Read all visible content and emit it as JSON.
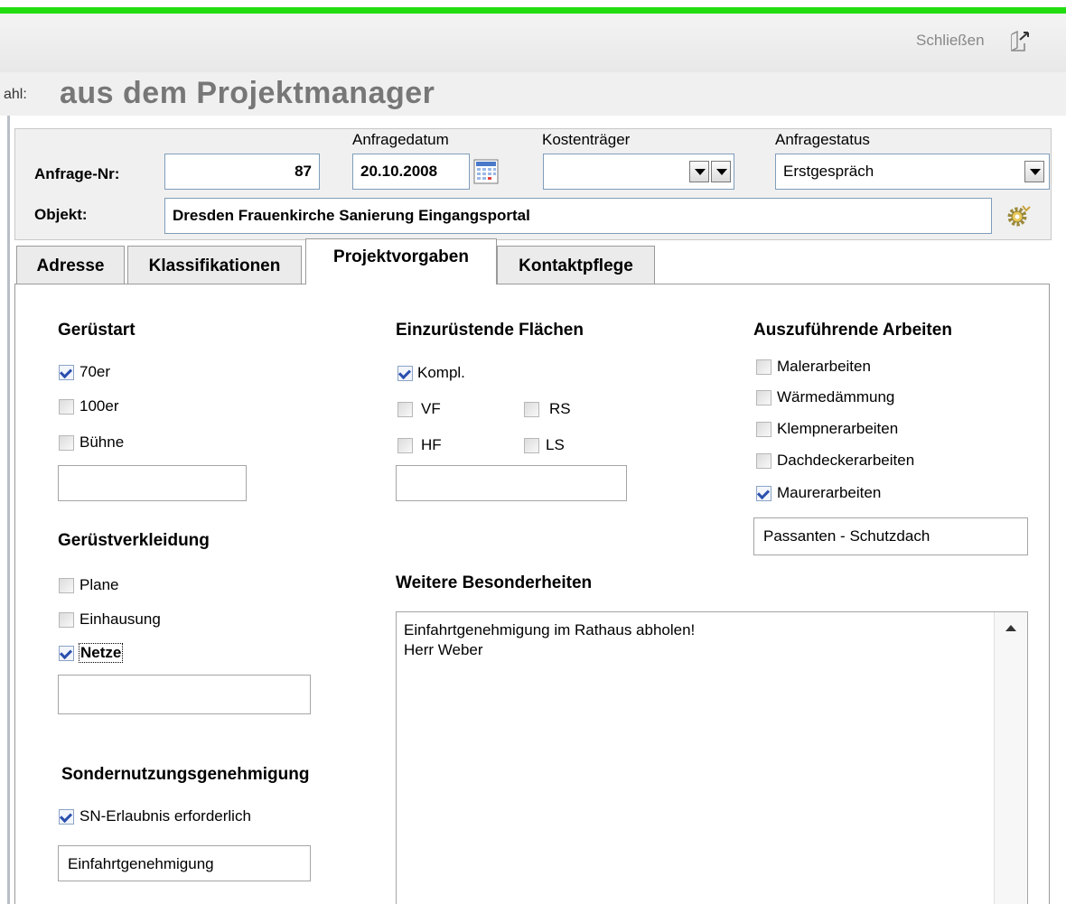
{
  "toolbar": {
    "close_label": "Schließen"
  },
  "title": {
    "prefix": "ahl:",
    "main": "aus dem Projektmanager"
  },
  "header": {
    "anfrage_nr_label": "Anfrage-Nr:",
    "anfrage_nr_value": "87",
    "anfragedatum_label": "Anfragedatum",
    "anfragedatum_value": "20.10.2008",
    "kostentraeger_label": "Kostenträger",
    "kostentraeger_value": "",
    "anfragestatus_label": "Anfragestatus",
    "anfragestatus_value": "Erstgespräch",
    "objekt_label": "Objekt:",
    "objekt_value": "Dresden Frauenkirche Sanierung Eingangsportal"
  },
  "tabs": [
    {
      "label": "Adresse",
      "active": false
    },
    {
      "label": "Klassifikationen",
      "active": false
    },
    {
      "label": "Projektvorgaben",
      "active": true
    },
    {
      "label": "Kontaktpflege",
      "active": false
    }
  ],
  "geruestart": {
    "title": "Gerüstart",
    "items": [
      {
        "label": "70er",
        "checked": true
      },
      {
        "label": "100er",
        "checked": false
      },
      {
        "label": "Bühne",
        "checked": false
      }
    ],
    "text": ""
  },
  "geruestverkleidung": {
    "title": "Gerüstverkleidung",
    "items": [
      {
        "label": "Plane",
        "checked": false
      },
      {
        "label": "Einhausung",
        "checked": false
      },
      {
        "label": "Netze",
        "checked": true
      }
    ],
    "text": ""
  },
  "sondernutzung": {
    "title": "Sondernutzungsgenehmigung",
    "items": [
      {
        "label": "SN-Erlaubnis erforderlich",
        "checked": true
      }
    ],
    "text": "Einfahrtgenehmigung"
  },
  "flaechen": {
    "title": "Einzurüstende Flächen",
    "items": [
      {
        "label": "Kompl.",
        "checked": true
      },
      {
        "label": "VF",
        "checked": false
      },
      {
        "label": "RS",
        "checked": false
      },
      {
        "label": "HF",
        "checked": false
      },
      {
        "label": "LS",
        "checked": false
      }
    ],
    "text": ""
  },
  "arbeiten": {
    "title": "Auszuführende Arbeiten",
    "items": [
      {
        "label": "Malerarbeiten",
        "checked": false
      },
      {
        "label": "Wärmedämmung",
        "checked": false
      },
      {
        "label": "Klempnerarbeiten",
        "checked": false
      },
      {
        "label": "Dachdeckerarbeiten",
        "checked": false
      },
      {
        "label": "Maurerarbeiten",
        "checked": true
      }
    ],
    "text": "Passanten - Schutzdach"
  },
  "besonderheiten": {
    "title": "Weitere Besonderheiten",
    "lines": [
      "Einfahrtgenehmigung im Rathaus abholen!",
      "Herr Weber"
    ]
  }
}
